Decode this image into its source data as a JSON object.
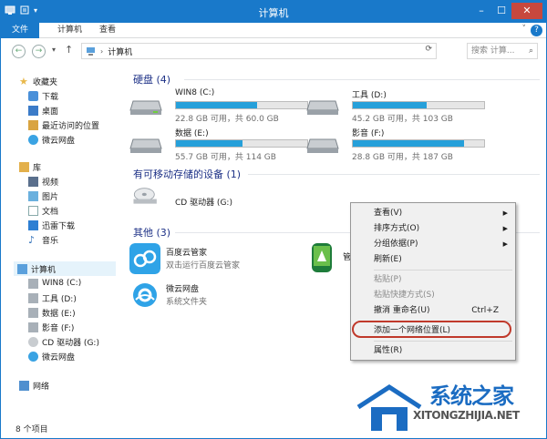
{
  "window": {
    "title": "计算机"
  },
  "ribbon": {
    "tabs": [
      "文件",
      "计算机",
      "查看"
    ]
  },
  "address": {
    "path": "计算机",
    "search_placeholder": "搜索 计算..."
  },
  "sidebar": {
    "favorites": {
      "label": "收藏夹",
      "items": [
        "下载",
        "桌面",
        "最近访问的位置",
        "微云网盘"
      ]
    },
    "libraries": {
      "label": "库",
      "items": [
        "视频",
        "图片",
        "文档",
        "迅雷下载",
        "音乐"
      ]
    },
    "computer": {
      "label": "计算机",
      "items": [
        "WIN8 (C:)",
        "工具 (D:)",
        "数据 (E:)",
        "影音 (F:)",
        "CD 驱动器 (G:)",
        "微云网盘"
      ]
    },
    "network": {
      "label": "网络"
    }
  },
  "groups": {
    "hard_disks": {
      "title": "硬盘 (4)"
    },
    "removable": {
      "title": "有可移动存储的设备 (1)"
    },
    "other": {
      "title": "其他 (3)"
    }
  },
  "drives": [
    {
      "name": "WIN8 (C:)",
      "info": "22.8 GB 可用，共 60.0 GB",
      "used": 0.62
    },
    {
      "name": "工具 (D:)",
      "info": "45.2 GB 可用，共 103 GB",
      "used": 0.56
    },
    {
      "name": "数据 (E:)",
      "info": "55.7 GB 可用，共 114 GB",
      "used": 0.51
    },
    {
      "name": "影音 (F:)",
      "info": "28.8 GB 可用，共 187 GB",
      "used": 0.85
    }
  ],
  "removable_drive": {
    "name": "CD 驱动器 (G:)"
  },
  "apps": [
    {
      "name": "百度云管家",
      "desc": "双击运行百度云管家"
    },
    {
      "name": "微云网盘",
      "desc": "系统文件夹"
    },
    {
      "name": "管"
    }
  ],
  "context_menu": {
    "items": [
      {
        "label": "查看(V)"
      },
      {
        "label": "排序方式(O)"
      },
      {
        "label": "分组依据(P)"
      },
      {
        "label": "刷新(E)"
      },
      {
        "label": "粘贴(P)"
      },
      {
        "label": "粘贴快捷方式(S)"
      },
      {
        "label": "撤消 重命名(U)",
        "shortcut": "Ctrl+Z"
      },
      {
        "label": "添加一个网络位置(L)"
      },
      {
        "label": "属性(R)"
      }
    ]
  },
  "status": {
    "count": "8 个项目"
  },
  "watermark": {
    "text": "系统之家",
    "url": "XITONGZHIJIA.NET"
  },
  "colors": {
    "accent": "#1979ca",
    "drive_bar": "#26a0da",
    "highlight": "#c0392b"
  }
}
